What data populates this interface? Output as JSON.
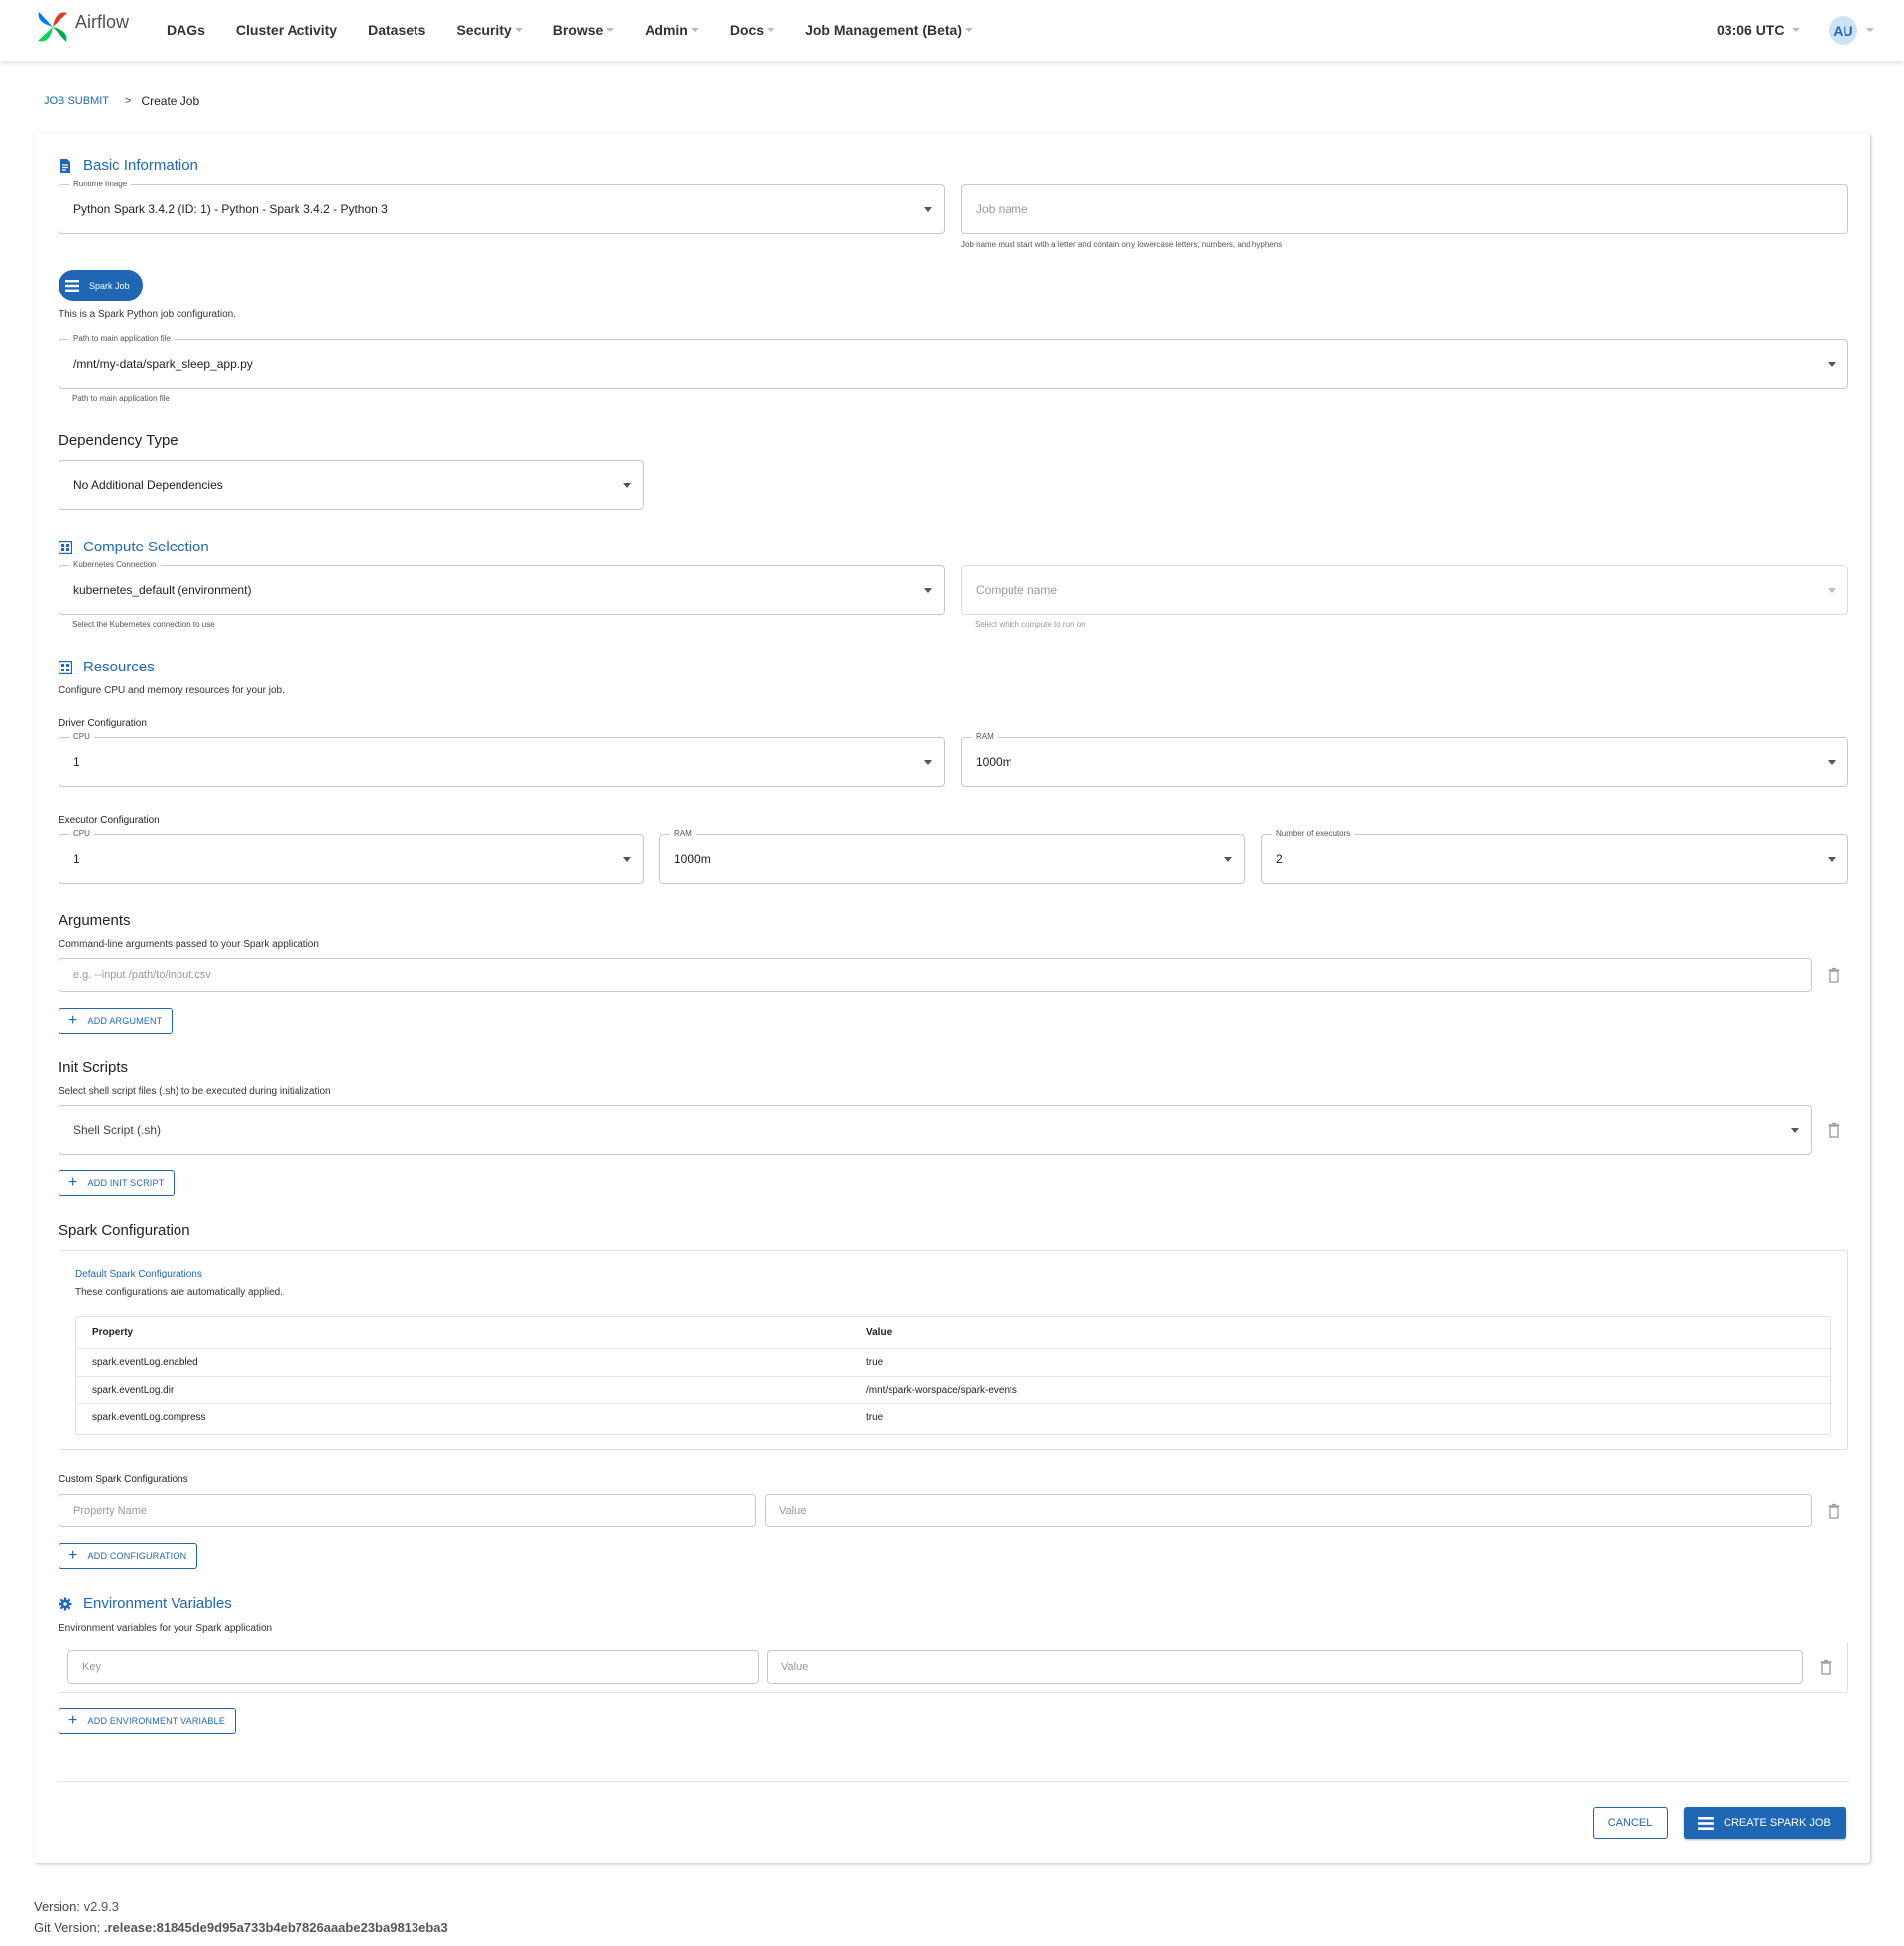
{
  "nav": {
    "brand": "Airflow",
    "items": [
      {
        "label": "DAGs",
        "caret": false
      },
      {
        "label": "Cluster Activity",
        "caret": false
      },
      {
        "label": "Datasets",
        "caret": false
      },
      {
        "label": "Security",
        "caret": true
      },
      {
        "label": "Browse",
        "caret": true
      },
      {
        "label": "Admin",
        "caret": true
      },
      {
        "label": "Docs",
        "caret": true
      },
      {
        "label": "Job Management (Beta)",
        "caret": true
      }
    ],
    "time": "03:06 UTC",
    "avatar": "AU"
  },
  "breadcrumb": {
    "parent": "JOB SUBMIT",
    "separator": ">",
    "current": "Create Job"
  },
  "basic": {
    "title": "Basic Information",
    "runtime_label": "Runtime Image",
    "runtime_value": "Python Spark 3.4.2 (ID: 1) - Python - Spark 3.4.2 - Python 3",
    "jobname_placeholder": "Job name",
    "jobname_hint": "Job name must start with a letter and contain only lowercase letters, numbers, and hyphens",
    "pill": "Spark Job",
    "desc": "This is a Spark Python job configuration.",
    "path_label": "Path to main application file",
    "path_value": "/mnt/my-data/spark_sleep_app.py",
    "path_hint": "Path to main application file"
  },
  "dependency": {
    "title": "Dependency Type",
    "value": "No Additional Dependencies"
  },
  "compute": {
    "title": "Compute Selection",
    "conn_label": "Kubernetes Connection",
    "conn_value": "kubernetes_default (environment)",
    "conn_hint": "Select the Kubernetes connection to use",
    "name_placeholder": "Compute name",
    "name_hint": "Select which compute to run on"
  },
  "resources": {
    "title": "Resources",
    "desc": "Configure CPU and memory resources for your job.",
    "driver_title": "Driver Configuration",
    "driver_cpu_label": "CPU",
    "driver_cpu": "1",
    "driver_ram_label": "RAM",
    "driver_ram": "1000m",
    "executor_title": "Executor Configuration",
    "exec_cpu_label": "CPU",
    "exec_cpu": "1",
    "exec_ram_label": "RAM",
    "exec_ram": "1000m",
    "exec_num_label": "Number of executors",
    "exec_num": "2"
  },
  "arguments": {
    "title": "Arguments",
    "desc": "Command-line arguments passed to your Spark application",
    "placeholder": "e.g. --input /path/to/input.csv",
    "add": "ADD ARGUMENT"
  },
  "init": {
    "title": "Init Scripts",
    "desc": "Select shell script files (.sh) to be executed during initialization",
    "placeholder": "Shell Script (.sh)",
    "add": "ADD INIT SCRIPT"
  },
  "spark": {
    "title": "Spark Configuration",
    "default_title": "Default Spark Configurations",
    "default_desc": "These configurations are automatically applied.",
    "headers": [
      "Property",
      "Value"
    ],
    "rows": [
      [
        "spark.eventLog.enabled",
        "true"
      ],
      [
        "spark.eventLog.dir",
        "/mnt/spark-worspace/spark-events"
      ],
      [
        "spark.eventLog.compress",
        "true"
      ]
    ],
    "custom_title": "Custom Spark Configurations",
    "prop_placeholder": "Property Name",
    "value_placeholder": "Value",
    "add": "ADD CONFIGURATION"
  },
  "env": {
    "title": "Environment Variables",
    "desc": "Environment variables for your Spark application",
    "key_placeholder": "Key",
    "value_placeholder": "Value",
    "add": "ADD ENVIRONMENT VARIABLE"
  },
  "actions": {
    "cancel": "CANCEL",
    "create": "CREATE SPARK JOB"
  },
  "footer": {
    "version_label": "Version:",
    "version": "v2.9.3",
    "git_label": "Git Version:",
    "git": ".release:81845de9d95a733b4eb7826aaabe23ba9813eba3"
  },
  "colors": {
    "accent": "#1f67b5",
    "brand_red": "#e43921",
    "brand_teal": "#00ad46"
  },
  "icons": [
    "airflow-logo-icon",
    "document-icon",
    "list-icon",
    "grid-icon",
    "gear-icon",
    "trash-icon",
    "plus-icon",
    "chevron-down-icon"
  ]
}
